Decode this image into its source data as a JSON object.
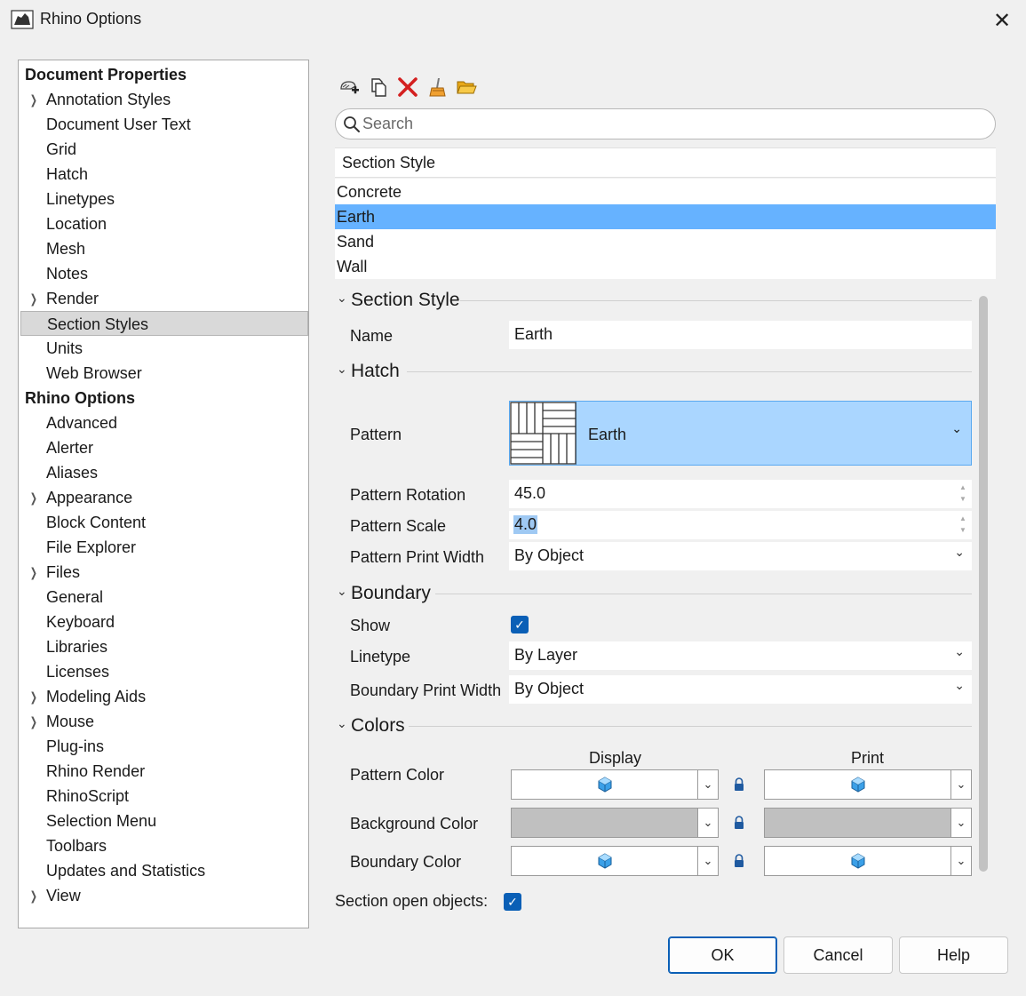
{
  "window": {
    "title": "Rhino Options"
  },
  "tree": [
    {
      "label": "Document Properties",
      "header": true,
      "chevron": false
    },
    {
      "label": "Annotation Styles",
      "chevron": true
    },
    {
      "label": "Document User Text"
    },
    {
      "label": "Grid"
    },
    {
      "label": "Hatch"
    },
    {
      "label": "Linetypes"
    },
    {
      "label": "Location"
    },
    {
      "label": "Mesh"
    },
    {
      "label": "Notes"
    },
    {
      "label": "Render",
      "chevron": true
    },
    {
      "label": "Section Styles",
      "selected": true
    },
    {
      "label": "Units"
    },
    {
      "label": "Web Browser"
    },
    {
      "label": "Rhino Options",
      "header": true
    },
    {
      "label": "Advanced"
    },
    {
      "label": "Alerter"
    },
    {
      "label": "Aliases"
    },
    {
      "label": "Appearance",
      "chevron": true
    },
    {
      "label": "Block Content"
    },
    {
      "label": "File Explorer"
    },
    {
      "label": "Files",
      "chevron": true
    },
    {
      "label": "General"
    },
    {
      "label": "Keyboard"
    },
    {
      "label": "Libraries"
    },
    {
      "label": "Licenses"
    },
    {
      "label": "Modeling Aids",
      "chevron": true
    },
    {
      "label": "Mouse",
      "chevron": true
    },
    {
      "label": "Plug-ins"
    },
    {
      "label": "Rhino Render"
    },
    {
      "label": "RhinoScript"
    },
    {
      "label": "Selection Menu"
    },
    {
      "label": "Toolbars"
    },
    {
      "label": "Updates and Statistics"
    },
    {
      "label": "View",
      "chevron": true
    }
  ],
  "toolbar": {
    "icons": [
      "new-style-icon",
      "duplicate-icon",
      "delete-icon",
      "clean-icon",
      "import-folder-icon"
    ]
  },
  "search": {
    "placeholder": "Search"
  },
  "style_list": {
    "header": "Section Style",
    "items": [
      "Concrete",
      "Earth",
      "Sand",
      "Wall"
    ],
    "selected": "Earth"
  },
  "props": {
    "section_style": {
      "title": "Section Style",
      "name_label": "Name",
      "name_value": "Earth"
    },
    "hatch": {
      "title": "Hatch",
      "pattern_label": "Pattern",
      "pattern_value": "Earth",
      "rotation_label": "Pattern Rotation",
      "rotation_value": "45.0",
      "scale_label": "Pattern Scale",
      "scale_value": "4.0",
      "print_width_label": "Pattern Print Width",
      "print_width_value": "By Object"
    },
    "boundary": {
      "title": "Boundary",
      "show_label": "Show",
      "show_checked": true,
      "linetype_label": "Linetype",
      "linetype_value": "By Layer",
      "print_width_label": "Boundary Print Width",
      "print_width_value": "By Object"
    },
    "colors": {
      "title": "Colors",
      "display_header": "Display",
      "print_header": "Print",
      "pattern_label": "Pattern Color",
      "background_label": "Background Color",
      "boundary_label": "Boundary Color",
      "swatch_gray": "#c0c0c0",
      "cube_color": "#3ba0e8"
    },
    "section_open_label": "Section open objects:",
    "section_open_checked": true
  },
  "buttons": {
    "ok": "OK",
    "cancel": "Cancel",
    "help": "Help"
  },
  "colors": {
    "selection_blue": "#66b2ff",
    "pattern_highlight": "#aad6ff",
    "accent": "#0a5fb6"
  }
}
